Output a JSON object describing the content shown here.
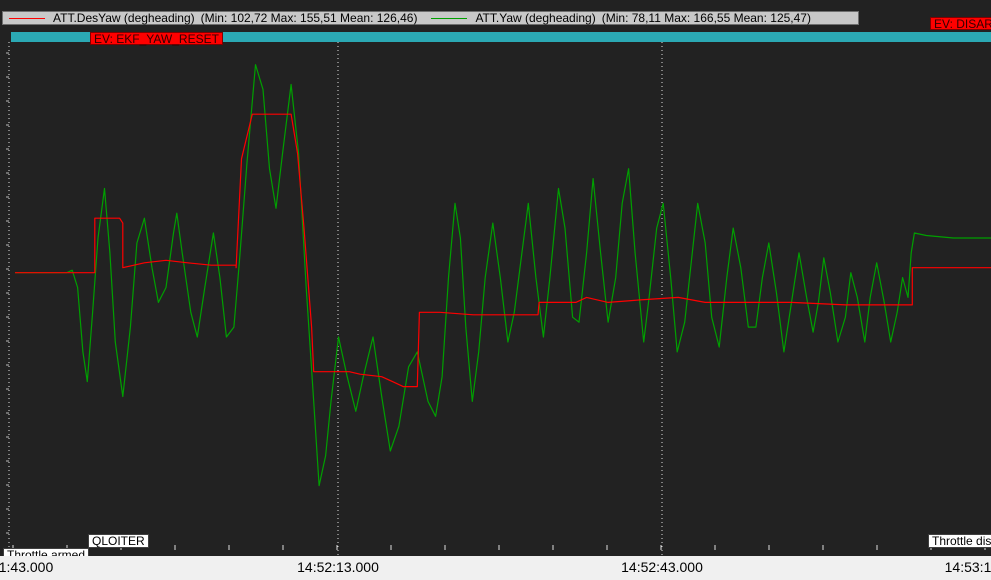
{
  "legend": {
    "entries": [
      {
        "name": "ATT.DesYaw (degheading)",
        "stats": "(Min: 102,72 Max: 155,51 Mean: 126,46)",
        "color": "#ff0000"
      },
      {
        "name": "ATT.Yaw (degheading)",
        "stats": "(Min: 78,11 Max: 166,55 Mean: 125,47)",
        "color": "#00a000"
      }
    ]
  },
  "events": {
    "ekf_reset": "EV: EKF_YAW_RESET",
    "disarm": "EV: DISAR"
  },
  "modes": {
    "throttle_armed": "Throttle armed",
    "qloiter": "QLOITER",
    "throttle_disarmed": "Throttle dis"
  },
  "time_axis": {
    "labels": [
      "1:43.000",
      "14:52:13.000",
      "14:52:43.000",
      "14:53:1"
    ]
  },
  "colors": {
    "background": "#222222",
    "grid": "#e0e0e0",
    "desyaw": "#ff0000",
    "yaw": "#00a000",
    "event_band": "#2ba9b4"
  },
  "chart_data": {
    "type": "line",
    "x_unit": "seconds (14:51:43 = 0)",
    "ylim": [
      70,
      175
    ],
    "xlim": [
      0,
      90.5
    ],
    "series": [
      {
        "name": "ATT.DesYaw (degheading)",
        "points": [
          [
            0,
            126
          ],
          [
            5.3,
            126
          ],
          [
            7.4,
            126
          ],
          [
            7.4,
            137
          ],
          [
            9.7,
            137
          ],
          [
            10,
            136
          ],
          [
            10,
            127
          ],
          [
            12,
            128
          ],
          [
            14,
            128.5
          ],
          [
            16,
            128
          ],
          [
            18.2,
            127.5
          ],
          [
            20.5,
            127.5
          ],
          [
            20.5,
            127
          ],
          [
            21,
            149
          ],
          [
            22,
            158
          ],
          [
            24.5,
            158
          ],
          [
            25.6,
            158
          ],
          [
            26.2,
            150
          ],
          [
            26.8,
            135
          ],
          [
            27.5,
            115
          ],
          [
            27.7,
            106
          ],
          [
            31,
            106
          ],
          [
            32,
            105.5
          ],
          [
            34,
            105
          ],
          [
            35,
            104
          ],
          [
            36,
            103
          ],
          [
            37.3,
            103
          ],
          [
            37.5,
            118
          ],
          [
            39.4,
            118
          ],
          [
            42.5,
            117.5
          ],
          [
            45,
            117.5
          ],
          [
            48.5,
            117.5
          ],
          [
            48.6,
            120
          ],
          [
            52,
            120
          ],
          [
            53,
            121
          ],
          [
            55,
            120
          ],
          [
            58,
            120.5
          ],
          [
            61.5,
            121
          ],
          [
            64,
            120
          ],
          [
            68,
            120
          ],
          [
            72,
            120
          ],
          [
            77,
            119.5
          ],
          [
            83.2,
            119.5
          ],
          [
            83.2,
            127
          ],
          [
            90.5,
            127
          ]
        ]
      },
      {
        "name": "ATT.Yaw (degheading)",
        "points": [
          [
            0,
            126
          ],
          [
            4.8,
            126
          ],
          [
            5.3,
            126.5
          ],
          [
            5.8,
            123
          ],
          [
            6.3,
            110
          ],
          [
            6.7,
            104
          ],
          [
            7.2,
            118
          ],
          [
            7.7,
            133
          ],
          [
            8.3,
            143
          ],
          [
            8.8,
            130
          ],
          [
            9.3,
            112
          ],
          [
            10,
            101
          ],
          [
            10.7,
            115
          ],
          [
            11.3,
            132
          ],
          [
            12,
            137
          ],
          [
            12.7,
            127
          ],
          [
            13.3,
            120
          ],
          [
            14,
            123
          ],
          [
            14.7,
            134
          ],
          [
            15,
            138
          ],
          [
            15.5,
            130
          ],
          [
            16.3,
            118
          ],
          [
            16.9,
            113
          ],
          [
            17.6,
            123
          ],
          [
            18.4,
            134
          ],
          [
            19,
            125
          ],
          [
            19.6,
            113
          ],
          [
            20.3,
            115
          ],
          [
            20.8,
            128
          ],
          [
            21.5,
            148
          ],
          [
            22.3,
            168
          ],
          [
            23,
            163
          ],
          [
            23.6,
            147
          ],
          [
            24.2,
            139
          ],
          [
            24.8,
            150
          ],
          [
            25.6,
            164
          ],
          [
            26.3,
            150
          ],
          [
            27,
            123
          ],
          [
            27.7,
            100
          ],
          [
            28.2,
            83
          ],
          [
            28.8,
            89
          ],
          [
            29.3,
            100
          ],
          [
            30,
            113
          ],
          [
            30.8,
            105
          ],
          [
            31.6,
            98
          ],
          [
            32.3,
            105
          ],
          [
            33.2,
            113
          ],
          [
            34,
            101
          ],
          [
            34.8,
            90
          ],
          [
            35.6,
            95
          ],
          [
            36.5,
            107
          ],
          [
            37.3,
            110
          ],
          [
            38.3,
            100
          ],
          [
            39,
            97
          ],
          [
            39.6,
            105
          ],
          [
            40.2,
            125
          ],
          [
            40.8,
            140
          ],
          [
            41.3,
            133
          ],
          [
            41.8,
            115
          ],
          [
            42.4,
            100
          ],
          [
            43,
            110
          ],
          [
            43.6,
            125
          ],
          [
            44.3,
            136
          ],
          [
            45,
            125
          ],
          [
            45.7,
            112
          ],
          [
            46.3,
            118
          ],
          [
            47,
            130
          ],
          [
            47.6,
            140
          ],
          [
            48.3,
            125
          ],
          [
            49,
            113
          ],
          [
            49.6,
            125
          ],
          [
            50.4,
            143
          ],
          [
            51,
            135
          ],
          [
            51.7,
            117
          ],
          [
            52.3,
            116
          ],
          [
            53,
            130
          ],
          [
            53.6,
            145
          ],
          [
            54.3,
            130
          ],
          [
            55,
            116
          ],
          [
            55.7,
            125
          ],
          [
            56.3,
            140
          ],
          [
            56.9,
            147
          ],
          [
            57.5,
            130
          ],
          [
            58.3,
            112
          ],
          [
            58.8,
            121
          ],
          [
            59.5,
            135
          ],
          [
            60.1,
            140
          ],
          [
            60.8,
            125
          ],
          [
            61.4,
            110
          ],
          [
            62.1,
            116
          ],
          [
            62.7,
            128
          ],
          [
            63.3,
            140
          ],
          [
            64,
            132
          ],
          [
            64.6,
            117
          ],
          [
            65.3,
            111
          ],
          [
            66,
            125
          ],
          [
            66.6,
            135
          ],
          [
            67.3,
            127
          ],
          [
            68,
            115
          ],
          [
            68.7,
            115
          ],
          [
            69.3,
            125
          ],
          [
            69.9,
            132
          ],
          [
            70.6,
            122
          ],
          [
            71.3,
            110
          ],
          [
            72,
            120
          ],
          [
            72.7,
            130
          ],
          [
            73.4,
            121
          ],
          [
            74,
            114
          ],
          [
            74.5,
            120
          ],
          [
            75,
            129
          ],
          [
            75.6,
            122
          ],
          [
            76.3,
            112
          ],
          [
            77,
            117
          ],
          [
            77.5,
            126
          ],
          [
            78.1,
            121
          ],
          [
            78.8,
            112
          ],
          [
            79.3,
            121
          ],
          [
            79.9,
            128
          ],
          [
            80.6,
            120
          ],
          [
            81.2,
            112
          ],
          [
            81.8,
            118
          ],
          [
            82.3,
            125
          ],
          [
            82.8,
            121
          ],
          [
            83.1,
            130
          ],
          [
            83.4,
            134
          ],
          [
            84.5,
            133.5
          ],
          [
            87,
            133
          ],
          [
            90.5,
            133
          ]
        ]
      }
    ],
    "time_labels": [
      "1:43.000",
      "14:52:13.000",
      "14:52:43.000",
      "14:53:1"
    ]
  }
}
